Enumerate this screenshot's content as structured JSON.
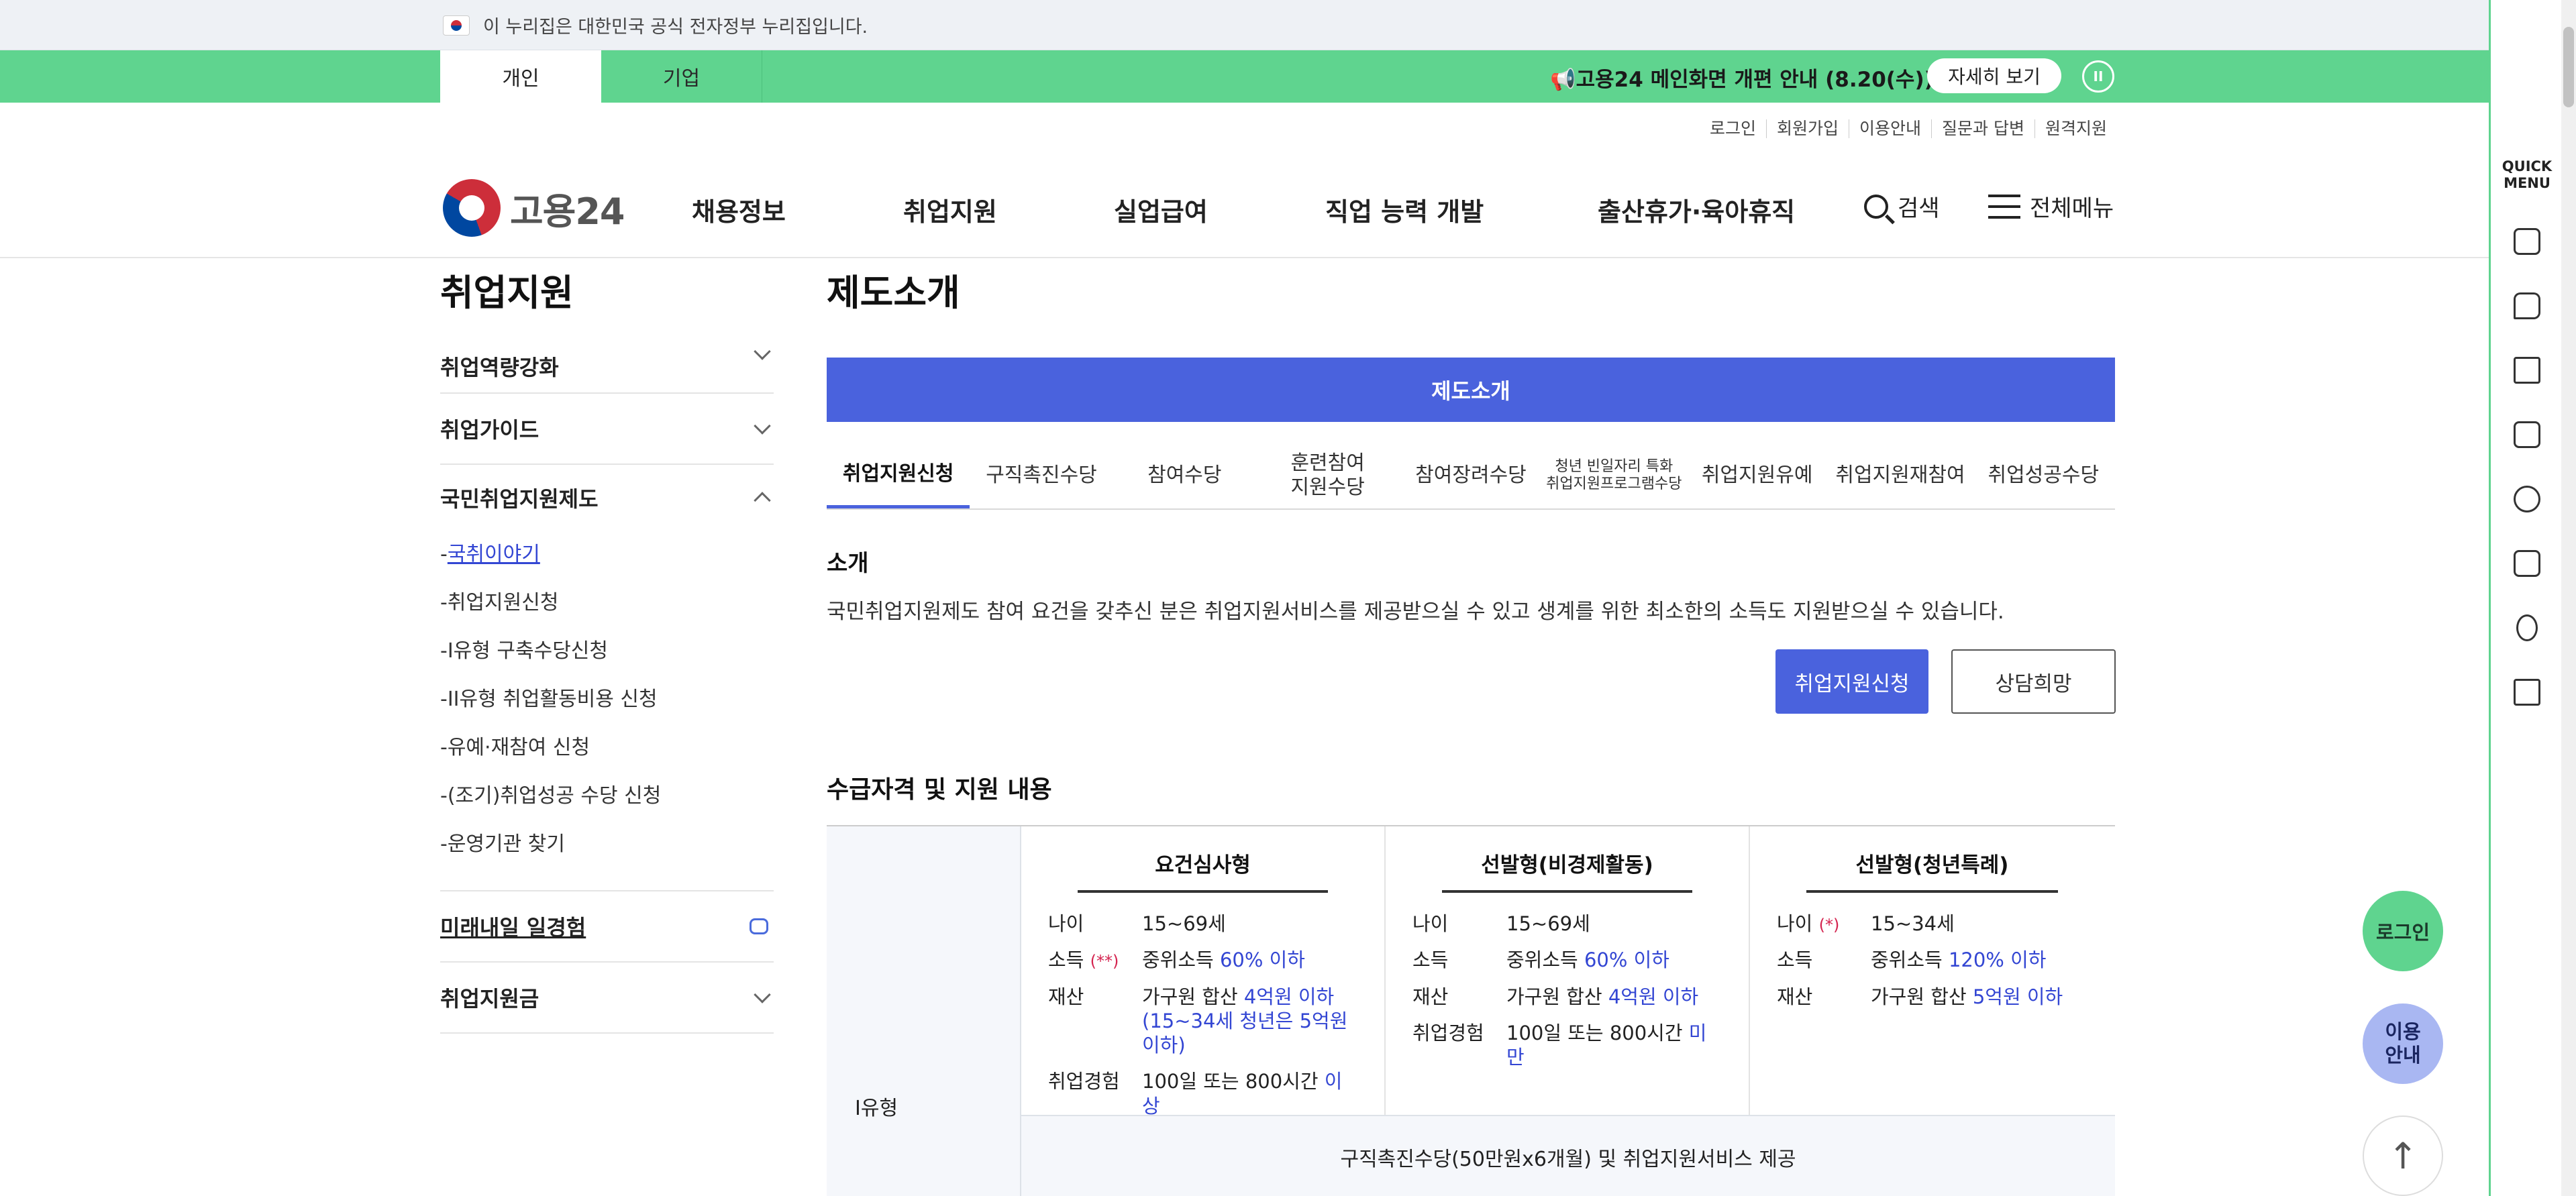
{
  "gov_banner": {
    "text": "이 누리집은 대한민국 공식 전자정부 누리집입니다."
  },
  "top_bar": {
    "tabs": [
      "개인",
      "기업"
    ],
    "notice": "📢고용24 메인화면 개편 안내 (8.20(수))",
    "notice_button": "자세히 보기",
    "pause_icon": "II",
    "color": "#5fd48f"
  },
  "util_links": [
    "로그인",
    "회원가입",
    "이용안내",
    "질문과 답변",
    "원격지원"
  ],
  "header": {
    "logo_text": "고용24",
    "nav": [
      "채용정보",
      "취업지원",
      "실업급여",
      "직업 능력 개발",
      "출산휴가·육아휴직"
    ],
    "search": "검색",
    "menu": "전체메뉴"
  },
  "sidebar": {
    "title": "취업지원",
    "items_top": [
      "취업역량강화",
      "취업가이드"
    ],
    "group": {
      "label": "국민취업지원제도",
      "subitems": [
        "국취이야기",
        "취업지원신청",
        "I유형 구축수당신청",
        "II유형 취업활동비용 신청",
        "유예·재참여 신청",
        "(조기)취업성공 수당 신청",
        "운영기관 찾기"
      ]
    },
    "items_bottom": [
      "미래내일 일경험",
      "취업지원금"
    ]
  },
  "main": {
    "title": "제도소개",
    "banner": "제도소개",
    "tabs": [
      "취업지원신청",
      "구직촉진수당",
      "참여수당",
      "훈련참여\n지원수당",
      "참여장려수당",
      "청년 빈일자리 특화\n취업지원프로그램수당",
      "취업지원유예",
      "취업지원재참여",
      "취업성공수당"
    ],
    "intro_heading": "소개",
    "intro_text": "국민취업지원제도 참여 요건을 갖추신 분은 취업지원서비스를 제공받으실 수 있고 생계를 위한 최소한의 소득도 지원받으실 수 있습니다.",
    "apply_button": "취업지원신청",
    "consult_button": "상담희망",
    "eligibility_heading": "수급자격 및 지원 내용",
    "table": {
      "row_label": "I유형",
      "columns": [
        {
          "head": "요건심사형",
          "age_key": "나이",
          "age_mark": "",
          "age_val": "15~69세",
          "income_key": "소득",
          "income_mark": "(**)",
          "income_pre": "중위소득 ",
          "income_hl": "60% 이하",
          "asset_key": "재산",
          "asset_pre": "가구원 합산 ",
          "asset_hl": "4억원 이하 (15~34세 청년은 5억원 이하)",
          "exp_key": "취업경험",
          "exp_pre": "100일 또는 800시간 ",
          "exp_hl": "이상"
        },
        {
          "head": "선발형(비경제활동)",
          "age_key": "나이",
          "age_mark": "",
          "age_val": "15~69세",
          "income_key": "소득",
          "income_mark": "",
          "income_pre": "중위소득 ",
          "income_hl": "60% 이하",
          "asset_key": "재산",
          "asset_pre": "가구원 합산 ",
          "asset_hl": "4억원 이하",
          "exp_key": "취업경험",
          "exp_pre": "100일 또는 800시간 ",
          "exp_hl": "미만"
        },
        {
          "head": "선발형(청년특례)",
          "age_key": "나이",
          "age_mark": "(*)",
          "age_val": "15~34세",
          "income_key": "소득",
          "income_mark": "",
          "income_pre": "중위소득 ",
          "income_hl": "120% 이하",
          "asset_key": "재산",
          "asset_pre": "가구원 합산 ",
          "asset_hl": "5억원 이하"
        }
      ],
      "benefit": "구직촉진수당(50만원x6개월) 및 취업지원서비스 제공"
    }
  },
  "quick_menu": {
    "title": "QUICK\nMENU",
    "icons": [
      "building-icon",
      "chat-icon",
      "monitor-icon",
      "checklist-icon",
      "smile-icon",
      "calculator-icon",
      "coins-icon",
      "printer-icon"
    ]
  },
  "floating": {
    "login": "로그인",
    "guide": "이용\n안내",
    "top": "↑"
  },
  "accent_color": "#4a62dd"
}
